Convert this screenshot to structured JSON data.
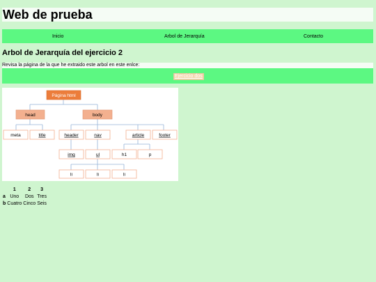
{
  "site": {
    "title": "Web de prueba"
  },
  "nav": {
    "items": [
      "Inicio",
      "Arbol de Jerarquía",
      "Contacto"
    ]
  },
  "section": {
    "title": "Arbol de Jerarquía del ejercicio 2",
    "info": "Revisa la página de la que he extraido este arbol en este enlce:",
    "link_label": "Ejercicio dos"
  },
  "tree": {
    "root": "Página html",
    "level1": [
      "head",
      "body"
    ],
    "level2": [
      "meta",
      "title",
      "header",
      "nav",
      "article",
      "footer"
    ],
    "level3": [
      "img",
      "ul",
      "h1",
      "p"
    ],
    "level4": [
      "li",
      "li",
      "li"
    ],
    "colors": {
      "primary": "#ec7d3b",
      "secondary": "#f3b08f",
      "line": "#95b3d7"
    }
  },
  "table": {
    "headers": [
      "",
      "1",
      "2",
      "3"
    ],
    "rows": [
      {
        "key": "a",
        "cells": [
          "Uno",
          "Dos",
          "Tres"
        ]
      },
      {
        "key": "b",
        "cells": [
          "Cuatro",
          "Cinco",
          "Seis"
        ]
      }
    ]
  },
  "colors": {
    "page_bg": "#cff5cf",
    "nav_bg": "#5cf882",
    "panel_bg": "#f5fcf5"
  }
}
